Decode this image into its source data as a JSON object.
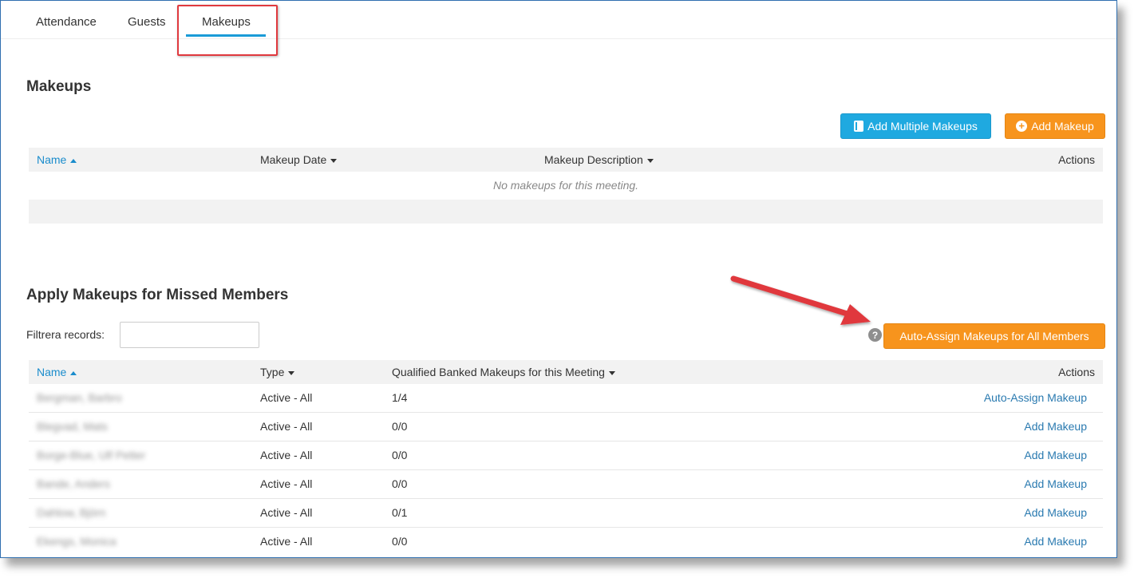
{
  "tabs": [
    {
      "label": "Attendance"
    },
    {
      "label": "Guests"
    },
    {
      "label": "Makeups"
    }
  ],
  "makeups_section": {
    "title": "Makeups",
    "add_multiple_label": "Add Multiple Makeups",
    "add_label": "Add Makeup",
    "columns": {
      "name": "Name",
      "date": "Makeup Date",
      "description": "Makeup Description",
      "actions": "Actions"
    },
    "empty_message": "No makeups for this meeting."
  },
  "apply_section": {
    "title": "Apply Makeups for Missed Members",
    "filter_label": "Filtrera records:",
    "filter_value": "",
    "auto_assign_all_label": "Auto-Assign Makeups for All Members",
    "help_glyph": "?",
    "columns": {
      "name": "Name",
      "type": "Type",
      "banked": "Qualified Banked Makeups for this Meeting",
      "actions": "Actions"
    },
    "rows": [
      {
        "name": "Bergman, Barbro",
        "type": "Active - All",
        "banked": "1/4",
        "action": "Auto-Assign Makeup"
      },
      {
        "name": "Blegvad, Mats",
        "type": "Active - All",
        "banked": "0/0",
        "action": "Add Makeup"
      },
      {
        "name": "Borge-Blue, Ulf Petter",
        "type": "Active - All",
        "banked": "0/0",
        "action": "Add Makeup"
      },
      {
        "name": "Bande, Anders",
        "type": "Active - All",
        "banked": "0/0",
        "action": "Add Makeup"
      },
      {
        "name": "Dahlow, Björn",
        "type": "Active - All",
        "banked": "0/1",
        "action": "Add Makeup"
      },
      {
        "name": "Ekengs, Monica",
        "type": "Active - All",
        "banked": "0/0",
        "action": "Add Makeup"
      }
    ]
  },
  "colors": {
    "accent_blue": "#1fa9e0",
    "accent_orange": "#f7941d",
    "link": "#2a7ab0",
    "annotation_red": "#e0393e"
  }
}
